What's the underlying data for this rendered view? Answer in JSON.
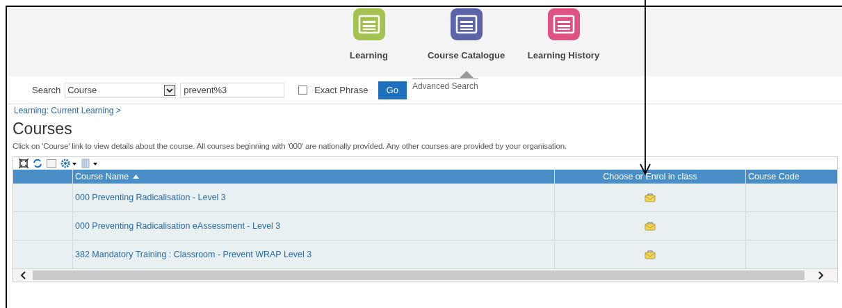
{
  "nav": [
    {
      "label": "Learning",
      "color": "#a4c24f",
      "selected": false
    },
    {
      "label": "Course Catalogue",
      "color": "#5b64a8",
      "selected": true
    },
    {
      "label": "Learning History",
      "color": "#de5384",
      "selected": false
    }
  ],
  "search": {
    "label": "Search",
    "scope": "Course",
    "query": "prevent%3",
    "exact_phrase": {
      "label": "Exact Phrase",
      "checked": false
    },
    "go": "Go",
    "advanced": "Advanced Search"
  },
  "breadcrumb": "Learning: Current Learning >",
  "title": "Courses",
  "description": "Click on 'Course' link to view details about the course. All courses beginning with '000' are nationally provided. Any other courses are provided by your organisation.",
  "table": {
    "columns": [
      "Course Name",
      "Choose or Enrol in class",
      "Course Code"
    ],
    "rows": [
      {
        "course_name": "000 Preventing Radicalisation - Level 3"
      },
      {
        "course_name": "000 Preventing Radicalisation eAssessment - Level 3"
      },
      {
        "course_name": "382 Mandatory Training : Classroom - Prevent WRAP Level 3"
      }
    ]
  }
}
